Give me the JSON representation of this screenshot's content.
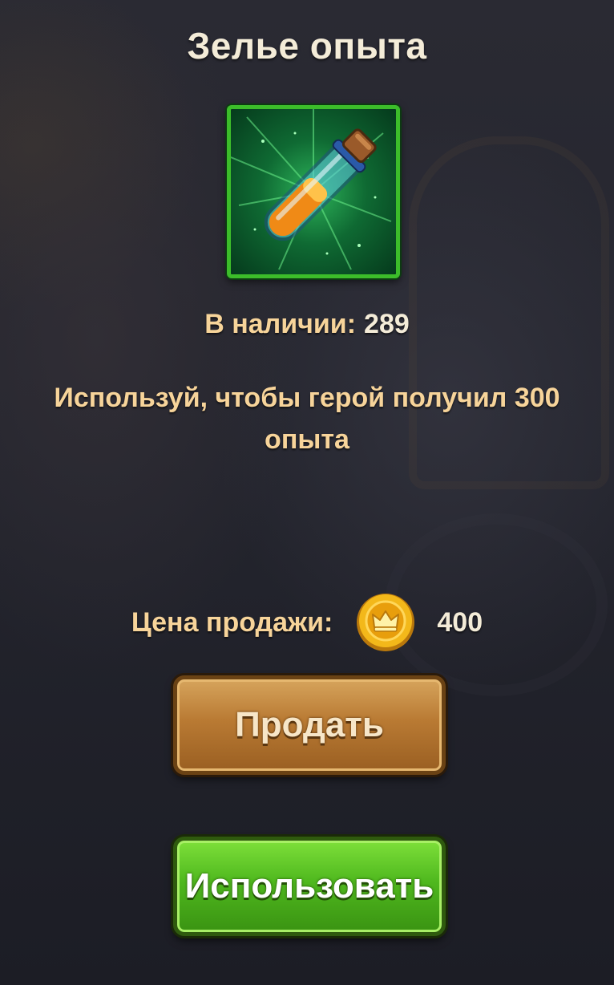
{
  "item": {
    "title": "Зелье опыта",
    "icon": "experience-potion-icon",
    "stock_label": "В наличии:",
    "stock_value": "289",
    "description": "Используй, чтобы герой получил 300 опыта"
  },
  "price": {
    "label": "Цена продажи:",
    "currency_icon": "gold-coin-crown-icon",
    "value": "400"
  },
  "buttons": {
    "sell_label": "Продать",
    "use_label": "Использовать"
  },
  "colors": {
    "item_frame": "#3cbd2a",
    "sell_button": "#b97a33",
    "use_button": "#4fb81e",
    "label_text": "#f7d49a"
  }
}
